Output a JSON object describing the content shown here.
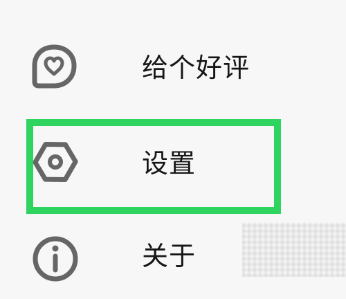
{
  "menu": {
    "items": [
      {
        "label": "给个好评",
        "icon": "heart-bubble-icon"
      },
      {
        "label": "设置",
        "icon": "hexagon-gear-icon"
      },
      {
        "label": "关于",
        "icon": "info-circle-icon"
      }
    ]
  },
  "highlight": {
    "color": "#2ed360",
    "target": "设置"
  },
  "colors": {
    "background": "#f7f7f7",
    "icon": "#666666",
    "text": "#161616"
  }
}
